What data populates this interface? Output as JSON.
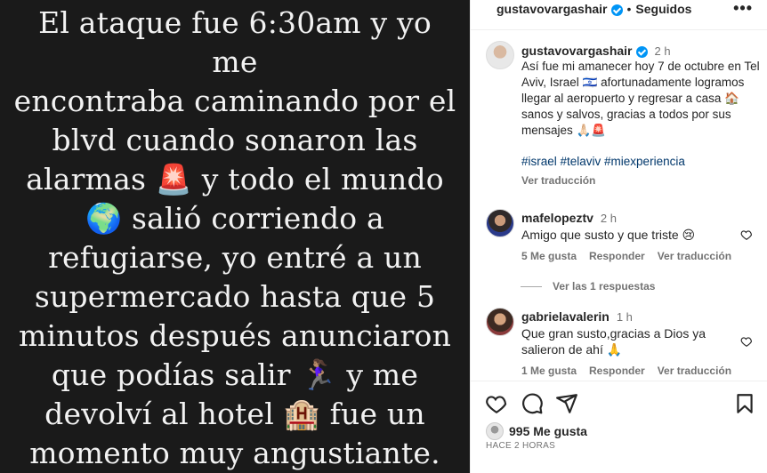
{
  "story": {
    "lines": [
      "El ataque fue 6:30am y yo me",
      "encontraba caminando por el",
      "blvd cuando sonaron las",
      "alarmas 🚨 y todo el mundo",
      "🌍 salió corriendo a",
      "refugiarse, yo entré a un",
      "supermercado hasta que 5",
      "minutos después anunciaron",
      "que podías salir 🏃🏽‍♀️ y me",
      "devolví al hotel 🏨 fue un",
      "momento muy angustiante."
    ]
  },
  "header": {
    "username": "gustavovargashair",
    "separator": "•",
    "following_label": "Seguidos",
    "more_label": "•••"
  },
  "caption": {
    "username": "gustavovargashair",
    "time": "2 h",
    "text": "Así fue mi amanecer hoy 7 de octubre en Tel Aviv, Israel 🇮🇱 afortunadamente logramos llegar al aeropuerto y regresar a casa 🏠 sanos y salvos, gracias a todos por sus mensajes 🙏🏻🚨",
    "hashtags": "#israel #telaviv #miexperiencia",
    "translate_label": "Ver traducción"
  },
  "comments": [
    {
      "username": "mafelopeztv",
      "time": "2 h",
      "text": "Amigo que susto y que triste 😢",
      "likes": "5 Me gusta",
      "reply_label": "Responder",
      "translate_label": "Ver traducción",
      "view_replies": "Ver las 1 respuestas"
    },
    {
      "username": "gabrielavalerin",
      "time": "1 h",
      "text": "Que gran susto,gracias a Dios ya salieron de ahí 🙏",
      "likes": "1 Me gusta",
      "reply_label": "Responder",
      "translate_label": "Ver traducción"
    }
  ],
  "footer": {
    "likes": "995 Me gusta",
    "posted": "HACE 2 HORAS"
  },
  "icons": [
    "heart-icon",
    "comment-icon",
    "share-icon",
    "bookmark-icon",
    "more-options-icon",
    "verified-badge-icon"
  ],
  "colors": {
    "link": "#00376b",
    "verified": "#0095f6",
    "muted": "#737373",
    "story_bg": "#1a1a1a"
  }
}
